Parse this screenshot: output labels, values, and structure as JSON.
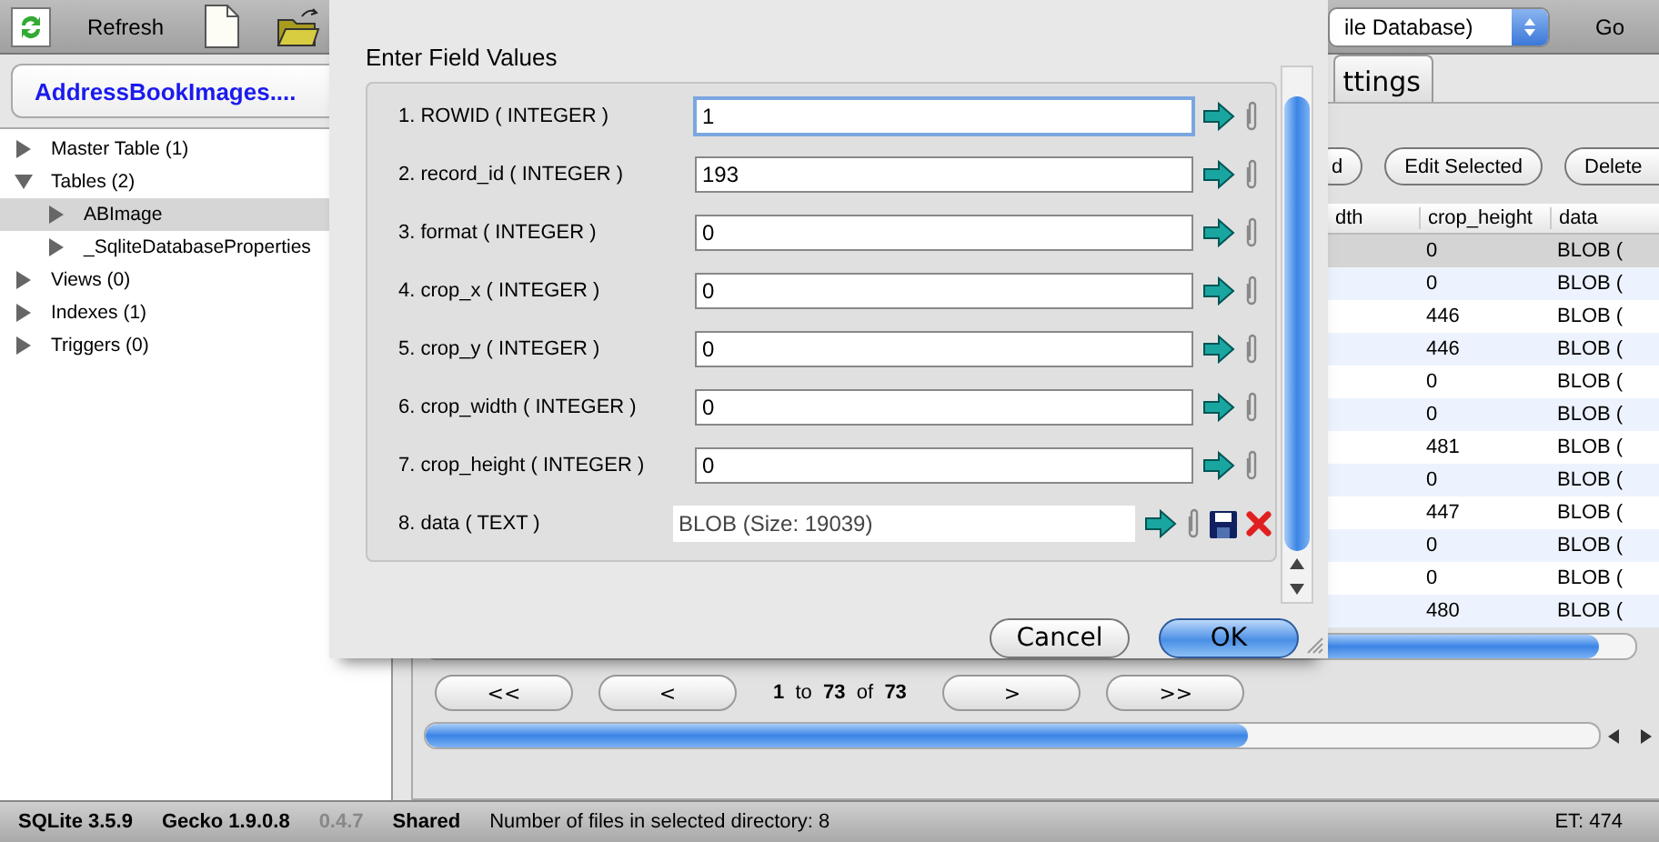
{
  "toolbar": {
    "refresh_label": "Refresh",
    "database_select": "ile Database)",
    "go_label": "Go"
  },
  "sidebar": {
    "database_button": "AddressBookImages....",
    "tree": [
      {
        "label": "Master Table (1)",
        "expanded": false,
        "selected": false
      },
      {
        "label": "Tables (2)",
        "expanded": true,
        "selected": false,
        "children": [
          {
            "label": "ABImage",
            "expanded": false,
            "selected": true
          },
          {
            "label": "_SqliteDatabaseProperties",
            "expanded": false,
            "selected": false
          }
        ]
      },
      {
        "label": "Views (0)",
        "expanded": false,
        "selected": false
      },
      {
        "label": "Indexes (1)",
        "expanded": false,
        "selected": false
      },
      {
        "label": "Triggers (0)",
        "expanded": false,
        "selected": false
      }
    ]
  },
  "tabs": [
    {
      "label": "ttings",
      "selected": false
    }
  ],
  "action_buttons": [
    "d",
    "Edit Selected",
    "Delete"
  ],
  "table": {
    "columns": [
      "dth",
      "crop_height",
      "data"
    ],
    "rows": [
      {
        "cells": [
          "",
          "0",
          "BLOB ("
        ],
        "selected": true
      },
      {
        "cells": [
          "",
          "0",
          "BLOB ("
        ],
        "selected": false
      },
      {
        "cells": [
          "",
          "446",
          "BLOB ("
        ],
        "selected": false
      },
      {
        "cells": [
          "",
          "446",
          "BLOB ("
        ],
        "selected": false
      },
      {
        "cells": [
          "",
          "0",
          "BLOB ("
        ],
        "selected": false
      },
      {
        "cells": [
          "",
          "0",
          "BLOB ("
        ],
        "selected": false
      },
      {
        "cells": [
          "",
          "481",
          "BLOB ("
        ],
        "selected": false
      },
      {
        "cells": [
          "",
          "0",
          "BLOB ("
        ],
        "selected": false
      },
      {
        "cells": [
          "",
          "447",
          "BLOB ("
        ],
        "selected": false
      },
      {
        "cells": [
          "",
          "0",
          "BLOB ("
        ],
        "selected": false
      },
      {
        "cells": [
          "",
          "0",
          "BLOB ("
        ],
        "selected": false
      },
      {
        "cells": [
          "",
          "480",
          "BLOB ("
        ],
        "selected": false
      }
    ]
  },
  "pager": {
    "first": "<<",
    "prev": "<",
    "from": "1",
    "to_word": "to",
    "to": "73",
    "of_word": "of",
    "total": "73",
    "next": ">",
    "last": ">>"
  },
  "status_bar": [
    {
      "text": "SQLite 3.5.9",
      "disabled": false
    },
    {
      "text": "Gecko 1.9.0.8",
      "disabled": false
    },
    {
      "text": "0.4.7",
      "disabled": true
    },
    {
      "text": "Shared",
      "disabled": false
    },
    {
      "text": "Number of files in selected directory: 8",
      "disabled": false
    },
    {
      "text": "ET: 474",
      "disabled": false
    }
  ],
  "dialog": {
    "title": "Enter Field Values",
    "fields": [
      {
        "label": "1. ROWID ( INTEGER )",
        "value": "1",
        "kind": "integer",
        "focused": true
      },
      {
        "label": "2. record_id ( INTEGER )",
        "value": "193",
        "kind": "integer",
        "focused": false
      },
      {
        "label": "3. format ( INTEGER )",
        "value": "0",
        "kind": "integer",
        "focused": false
      },
      {
        "label": "4. crop_x ( INTEGER )",
        "value": "0",
        "kind": "integer",
        "focused": false
      },
      {
        "label": "5. crop_y ( INTEGER )",
        "value": "0",
        "kind": "integer",
        "focused": false
      },
      {
        "label": "6. crop_width ( INTEGER )",
        "value": "0",
        "kind": "integer",
        "focused": false
      },
      {
        "label": "7. crop_height ( INTEGER )",
        "value": "0",
        "kind": "integer",
        "focused": false
      },
      {
        "label": "8. data ( TEXT )",
        "value": "BLOB (Size: 19039)",
        "kind": "blob",
        "focused": false
      }
    ],
    "buttons": [
      {
        "label": "Cancel",
        "default": false
      },
      {
        "label": "OK",
        "default": true
      }
    ]
  }
}
